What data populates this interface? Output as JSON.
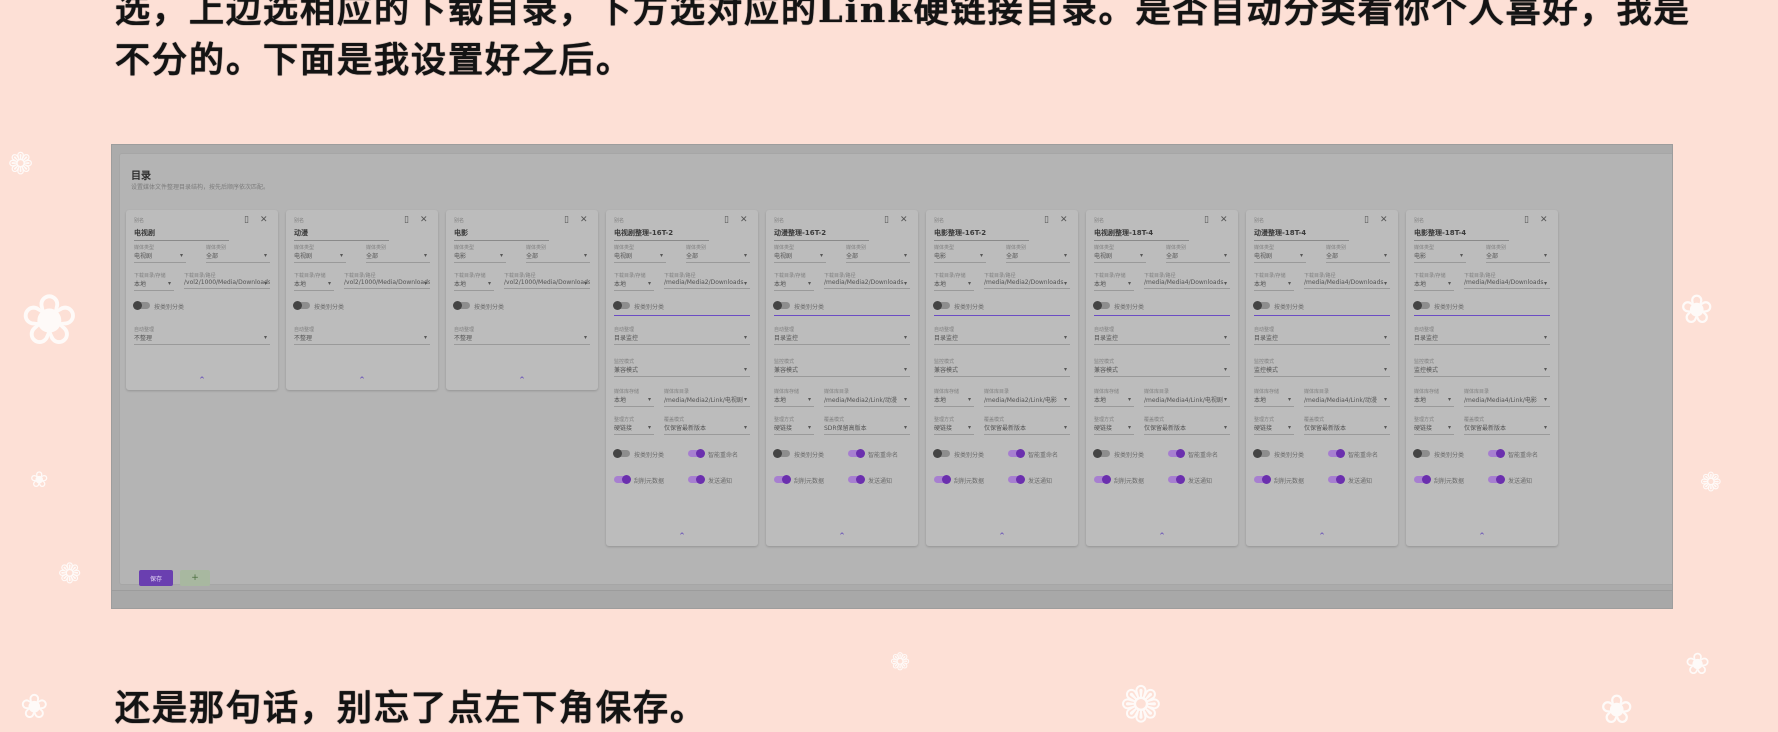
{
  "article": {
    "paragraph_top": "选，上边选相应的下载目录，下方选对应的Link硬链接目录。是否自动分类看你个人喜好，我是不分的。下面是我设置好之后。",
    "paragraph_bottom": "还是那句话，别忘了点左下角保存。"
  },
  "screenshot": {
    "section_title": "目录",
    "section_desc": "设置媒体文件整理目录结构，按先后顺序依次匹配。",
    "common_labels": {
      "alias": "别名",
      "media_type": "媒体类型",
      "media_category": "媒体类别",
      "download_storage": "下载目录/存储",
      "download_path": "下载目录/路径",
      "auto_category": "按类别分类",
      "organize_mode": "自动整理",
      "monitor_mode_caption": "监控模式",
      "monitor_mode_placeholder": "监控模式",
      "media_lib_storage": "媒体库存储",
      "media_lib_path": "媒体库目录",
      "organize_method": "整理方式",
      "overwrite_mode": "覆盖模式",
      "smart_rename": "智能重命名",
      "scrape": "刮削元数据",
      "notify": "发送通知",
      "collapse_icon": "chevron-up-icon",
      "delete_icon": "trash-icon",
      "close_icon": "close-icon"
    },
    "download_cards": [
      {
        "alias": "电视剧",
        "type": "电视剧",
        "category": "全部",
        "storage": "本地",
        "path": "/vol2/1000/Media/Downloads",
        "organize": "不整理"
      },
      {
        "alias": "动漫",
        "type": "电视剧",
        "category": "全部",
        "storage": "本地",
        "path": "/vol2/1000/Media/Downloads",
        "organize": "不整理"
      },
      {
        "alias": "电影",
        "type": "电影",
        "category": "全部",
        "storage": "本地",
        "path": "/vol2/1000/Media/Downloads",
        "organize": "不整理"
      }
    ],
    "library_cards": [
      {
        "alias": "电视剧整理-16T-2",
        "type": "电视剧",
        "category": "全部",
        "storage": "本地",
        "path": "/media/Media2/Downloads",
        "organize": "目录监控",
        "monitor": "兼容模式",
        "lib_storage": "本地",
        "lib_path": "/media/Media2/Link/电视剧",
        "method": "硬链接",
        "overwrite": "仅保留最新版本"
      },
      {
        "alias": "动漫整理-16T-2",
        "type": "电视剧",
        "category": "全部",
        "storage": "本地",
        "path": "/media/Media2/Downloads",
        "organize": "目录监控",
        "monitor": "兼容模式",
        "lib_storage": "本地",
        "lib_path": "/media/Media2/Link/动漫",
        "method": "硬链接",
        "overwrite": "SDR保留高版本"
      },
      {
        "alias": "电影整理-16T-2",
        "type": "电影",
        "category": "全部",
        "storage": "本地",
        "path": "/media/Media2/Downloads",
        "organize": "目录监控",
        "monitor": "兼容模式",
        "lib_storage": "本地",
        "lib_path": "/media/Media2/Link/电影",
        "method": "硬链接",
        "overwrite": "仅保留最新版本"
      },
      {
        "alias": "电视剧整理-18T-4",
        "type": "电视剧",
        "category": "全部",
        "storage": "本地",
        "path": "/media/Media4/Downloads",
        "organize": "目录监控",
        "monitor": "兼容模式",
        "lib_storage": "本地",
        "lib_path": "/media/Media4/Link/电视剧",
        "method": "硬链接",
        "overwrite": "仅保留最新版本"
      },
      {
        "alias": "动漫整理-18T-4",
        "type": "电视剧",
        "category": "全部",
        "storage": "本地",
        "path": "/media/Media4/Downloads",
        "organize": "目录监控",
        "monitor": "",
        "lib_storage": "本地",
        "lib_path": "/media/Media4/Link/动漫",
        "method": "硬链接",
        "overwrite": "仅保留最新版本"
      },
      {
        "alias": "电影整理-18T-4",
        "type": "电影",
        "category": "全部",
        "storage": "本地",
        "path": "/media/Media4/Downloads",
        "organize": "目录监控",
        "monitor": "",
        "lib_storage": "本地",
        "lib_path": "/media/Media4/Link/电影",
        "method": "硬链接",
        "overwrite": "仅保留最新版本"
      }
    ],
    "save_button": "保存",
    "add_button": "+"
  },
  "colors": {
    "page_bg": "#fde0d6",
    "accent_purple": "#6a3fb0",
    "add_green": "#4c6f40"
  }
}
